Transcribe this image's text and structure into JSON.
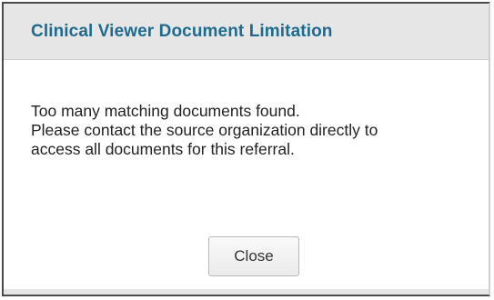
{
  "dialog": {
    "title": "Clinical Viewer Document Limitation",
    "message_lines": [
      "Too many matching documents found.",
      "Please contact the source organization directly to",
      "access all documents for this referral."
    ],
    "close_label": "Close"
  },
  "colors": {
    "title": "#1e6b8f",
    "header_background": "#e6e6e6",
    "text": "#222222"
  }
}
